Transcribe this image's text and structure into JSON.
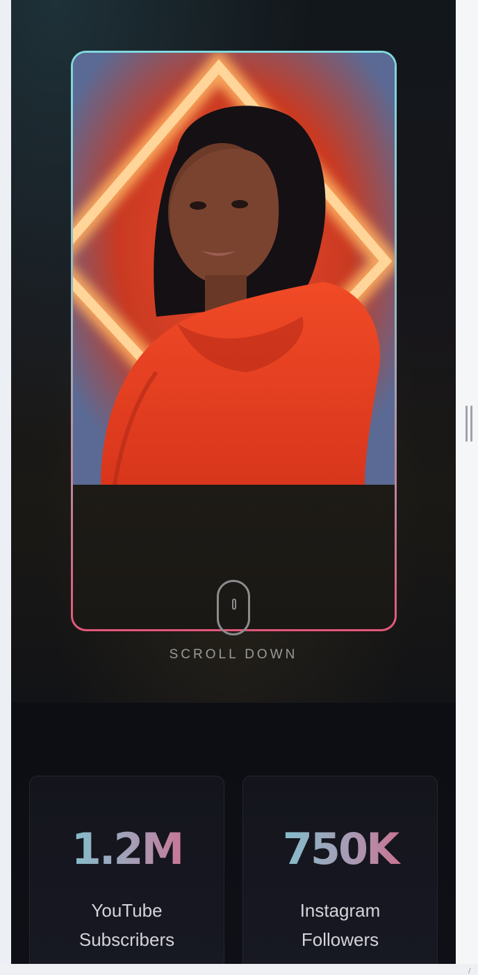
{
  "hero": {
    "portrait_alt": "Portrait of a woman in a red hoodie in front of a neon diamond",
    "scroll_label": "SCROLL DOWN"
  },
  "stats": [
    {
      "value": "1.2M",
      "label_line1": "YouTube",
      "label_line2": "Subscribers"
    },
    {
      "value": "750K",
      "label_line1": "Instagram",
      "label_line2": "Followers"
    }
  ],
  "colors": {
    "accent_teal": "#6fd2d8",
    "accent_pink": "#e4567a",
    "background": "#0d0f14"
  }
}
